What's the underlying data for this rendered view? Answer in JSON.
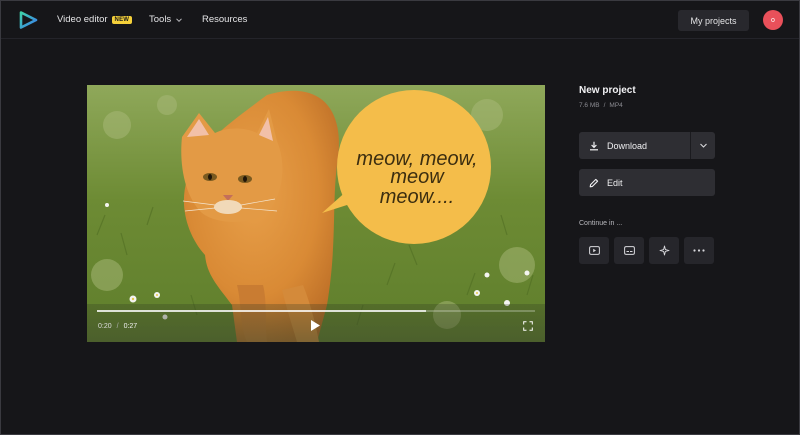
{
  "nav": {
    "video_editor": "Video editor",
    "new_badge": "NEW",
    "tools": "Tools",
    "resources": "Resources",
    "my_projects": "My projects",
    "avatar_initial": "o"
  },
  "player": {
    "speech_bubble": [
      "meow, meow,",
      "meow",
      "meow...."
    ],
    "current_time": "0:20",
    "separator": "/",
    "duration": "0:27",
    "progress": 0.75
  },
  "project": {
    "title": "New project",
    "size": "7.6 MB",
    "meta_separator": "/",
    "format": "MP4"
  },
  "actions": {
    "download": "Download",
    "edit": "Edit",
    "continue_in": "Continue in ..."
  },
  "icons": {
    "logo": "play-logo-icon",
    "download": "download-icon",
    "edit": "pencil-icon",
    "continue": [
      "video-player-icon",
      "subtitles-icon",
      "sparkle-icon",
      "more-icon"
    ]
  },
  "colors": {
    "background": "#161619",
    "button": "#2e2e33",
    "badge": "#f5d03a",
    "avatar": "#e9505a",
    "bubble": "#f4bd4a"
  }
}
